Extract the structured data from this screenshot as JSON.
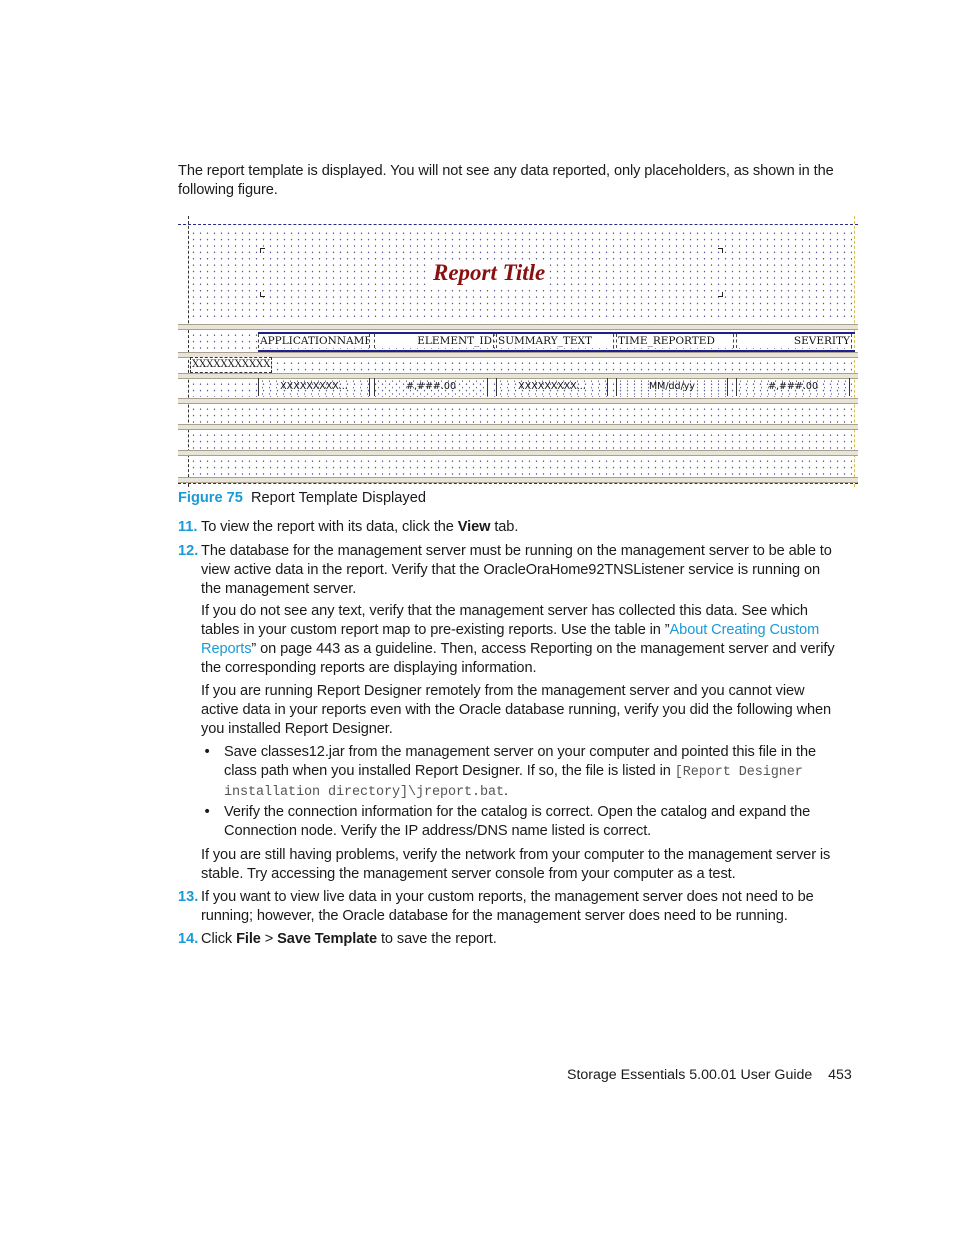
{
  "intro": "The report template is displayed. You will not see any data reported, only placeholders, as shown in the following figure.",
  "figure": {
    "report_title": "Report Title",
    "header_columns": [
      "APPLICATIONNAME",
      "ELEMENT_ID",
      "SUMMARY_TEXT",
      "TIME_REPORTED",
      "SEVERITY"
    ],
    "group_field": "XXXXXXXXXXX",
    "detail_fields": [
      "XXXXXXXXX...",
      "#,###.00",
      "XXXXXXXXX...",
      "MM/dd/yy",
      "#,###.00"
    ],
    "colors": {
      "title": "#8a1010",
      "header_border": "#20208a"
    }
  },
  "caption": {
    "label": "Figure 75",
    "text": "Report Template Displayed"
  },
  "steps": [
    {
      "num": "11.",
      "pre": "To view the report with its data, click the ",
      "bold": "View",
      "post": " tab."
    },
    {
      "num": "12.",
      "text": "The database for the management server must be running on the management server to be able to view active data in the report. Verify that the OracleOraHome92TNSListener service is running on the management server."
    },
    {
      "num": "13.",
      "text": "If you want to view live data in your custom reports, the management server does not need to be running; however, the Oracle database for the management server does need to be running."
    },
    {
      "num": "14.",
      "pre": "Click ",
      "bold1": "File",
      "mid": " > ",
      "bold2": "Save Template",
      "post": " to save the report."
    }
  ],
  "para_no_text": {
    "pre": "If you do not see any text, verify that the management server has collected this data. See which tables in your custom report map to pre-existing reports. Use the table in ”",
    "link": "About Creating Custom Reports",
    "post": "” on page 443 as a guideline. Then, access Reporting on the management server and verify the corresponding reports are displaying information."
  },
  "para_remote": "If you are running Report Designer remotely from the management server and you cannot view active data in your reports even with the Oracle database running, verify you did the following when you installed Report Designer.",
  "bullets": [
    {
      "pre": "Save classes12.jar from the management server on your computer and pointed this file in the class path when you installed Report Designer. If so, the file is listed in ",
      "code": "[Report Designer installation directory]\\jreport.bat",
      "post": "."
    },
    {
      "text": "Verify the connection information for the catalog is correct. Open the catalog and expand the Connection node. Verify the IP address/DNS name listed is correct."
    }
  ],
  "para_still": "If you are still having problems, verify the network from your computer to the management server is stable. Try accessing the management server console from your computer as a test.",
  "footer": {
    "guide": "Storage Essentials 5.00.01 User Guide",
    "page": "453"
  },
  "link_color": "#1a9ad6"
}
